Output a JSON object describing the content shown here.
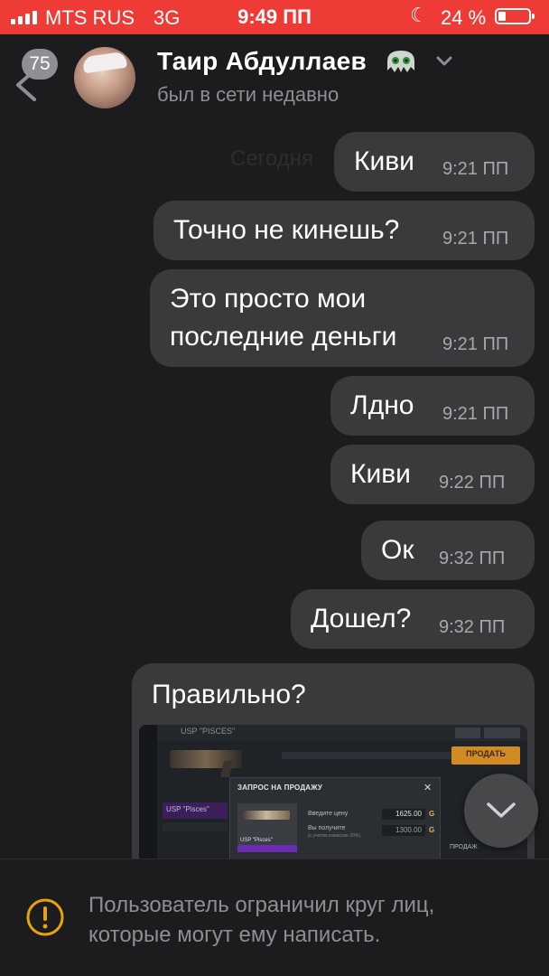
{
  "status_bar": {
    "carrier": "MTS RUS",
    "network": "3G",
    "time": "9:49 ПП",
    "battery_percent": "24 %",
    "battery_level": 0.24
  },
  "header": {
    "unread_count": "75",
    "contact_name": "Таир Абдуллаев",
    "last_seen": "был в сети недавно",
    "name_emoji": "alien-monster-emoji"
  },
  "ghost_date": "Сегодня",
  "messages": [
    {
      "text": "Киви",
      "time": "9:21 ПП"
    },
    {
      "text": "Точно не кинешь?",
      "time": "9:21 ПП"
    },
    {
      "lines": [
        "Это просто мои",
        "последние деньги"
      ],
      "time": "9:21 ПП"
    },
    {
      "text": "Лдно",
      "time": "9:21 ПП"
    },
    {
      "text": "Киви",
      "time": "9:22 ПП"
    },
    {
      "text": "Ок",
      "time": "9:32 ПП"
    },
    {
      "text": "Дошел?",
      "time": "9:32 ПП"
    },
    {
      "text": "Правильно?"
    }
  ],
  "attached_screenshot": {
    "item_title": "USP \"PISCES\"",
    "modal_title": "ЗАПРОС НА ПРОДАЖУ",
    "item_card_label": "USP \"Pisces\"",
    "price_label": "Введите цену",
    "receive_label": "Вы получите",
    "receive_note": "(с учетом комиссии 20%)",
    "price_value": "1625.00",
    "receive_value": "1300.00",
    "currency_icon": "G",
    "sell_button": "ПРОДАТЬ",
    "sell_label_2": "ПРОДАЖ"
  },
  "footer": {
    "restriction_text": "Пользователь ограничил круг лиц, которые могут ему написать."
  },
  "colors": {
    "status_bar": "#ef3b36",
    "background": "#1c1c1e",
    "bubble": "#3a3a3c",
    "secondary_text": "#8e8e93",
    "warning_icon": "#e5a50a"
  }
}
